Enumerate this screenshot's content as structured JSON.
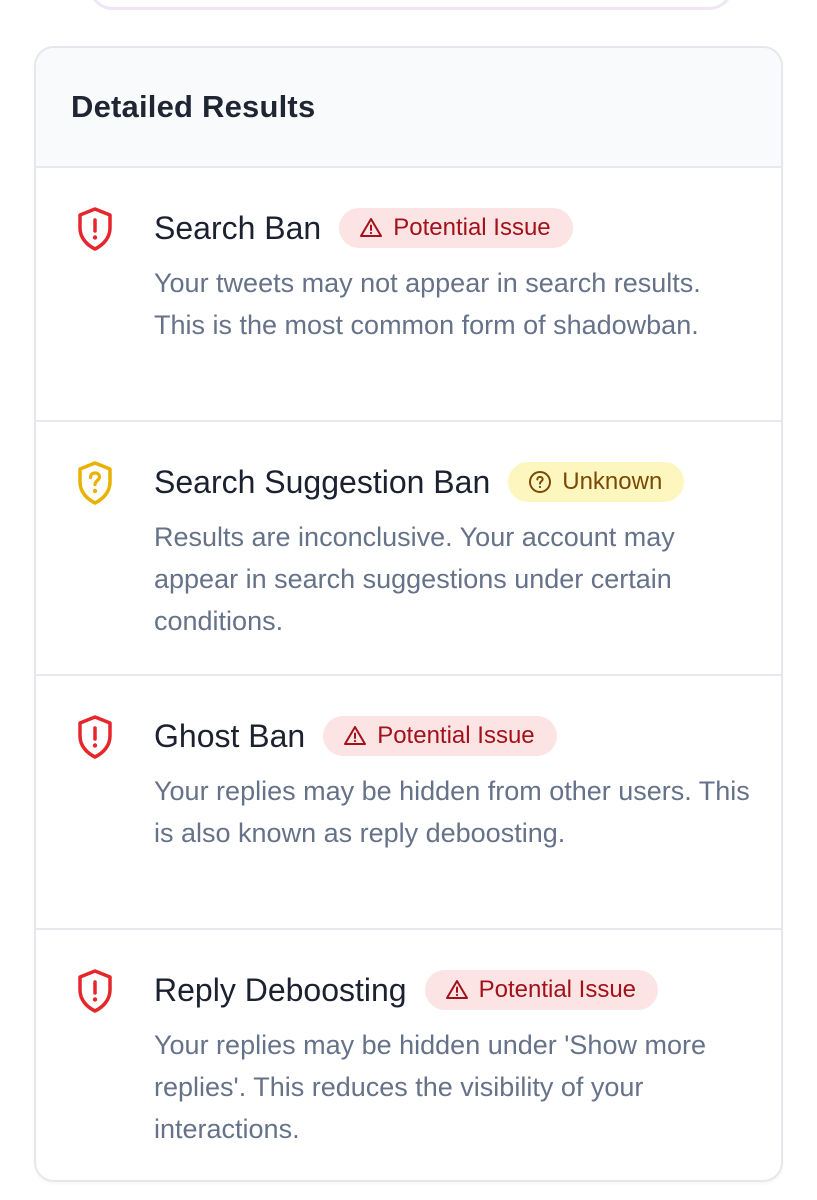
{
  "section": {
    "title": "Detailed Results"
  },
  "results": [
    {
      "title": "Search Ban",
      "status": "Potential Issue",
      "status_type": "issue",
      "icon": "shield-alert-icon",
      "description": "Your tweets may not appear in search results. This is the most common form of shadowban."
    },
    {
      "title": "Search Suggestion Ban",
      "status": "Unknown",
      "status_type": "unknown",
      "icon": "shield-question-icon",
      "description": "Results are inconclusive. Your account may appear in search suggestions under certain conditions."
    },
    {
      "title": "Ghost Ban",
      "status": "Potential Issue",
      "status_type": "issue",
      "icon": "shield-alert-icon",
      "description": "Your replies may be hidden from other users. This is also known as reply deboosting."
    },
    {
      "title": "Reply Deboosting",
      "status": "Potential Issue",
      "status_type": "issue",
      "icon": "shield-alert-icon",
      "description": "Your replies may be hidden under 'Show more replies'. This reduces the visibility of your interactions."
    }
  ],
  "colors": {
    "issue": "#e5262b",
    "issue_badge_bg": "#fde4e4",
    "issue_badge_text": "#a3111b",
    "unknown": "#e9b100",
    "unknown_badge_bg": "#fdf7bf",
    "unknown_badge_text": "#7a4a05"
  }
}
